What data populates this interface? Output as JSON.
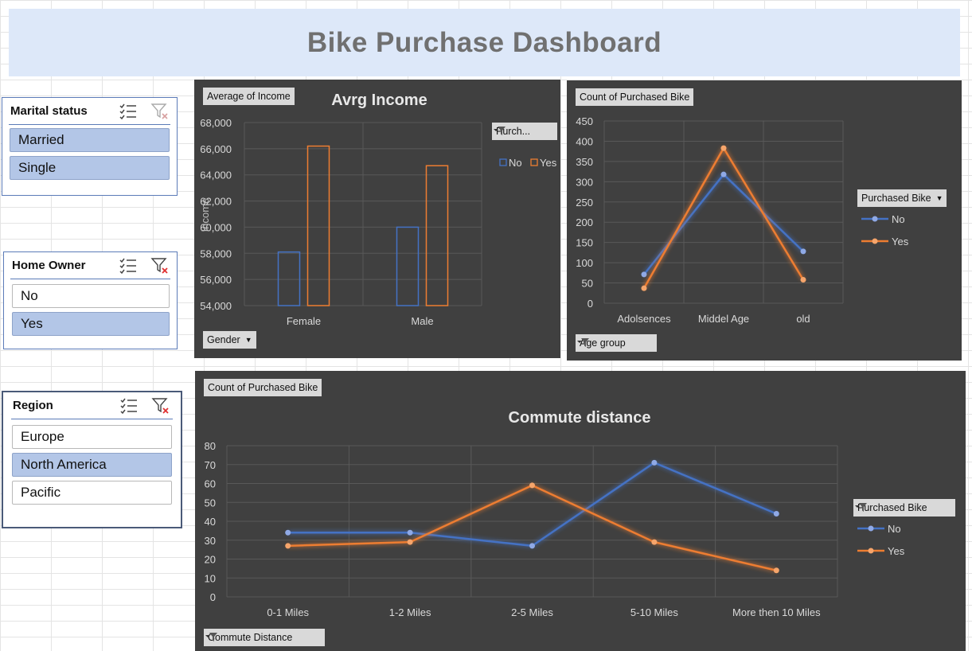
{
  "title": "Bike Purchase Dashboard",
  "colors": {
    "no": "#4472c4",
    "yes": "#ed7d31",
    "panel": "#404040",
    "selected": "#b3c6e7"
  },
  "slicers": {
    "marital": {
      "label": "Marital status",
      "items": [
        {
          "label": "Married",
          "selected": true
        },
        {
          "label": "Single",
          "selected": true
        }
      ],
      "icons": [
        "multi-select-icon",
        "clear-filter-icon"
      ]
    },
    "home_owner": {
      "label": "Home Owner",
      "items": [
        {
          "label": "No",
          "selected": false
        },
        {
          "label": "Yes",
          "selected": true
        }
      ],
      "icons": [
        "multi-select-icon",
        "clear-filter-icon"
      ]
    },
    "region": {
      "label": "Region",
      "items": [
        {
          "label": "Europe",
          "selected": false
        },
        {
          "label": "North America",
          "selected": true
        },
        {
          "label": "Pacific",
          "selected": false
        }
      ],
      "icons": [
        "multi-select-icon",
        "clear-filter-icon"
      ]
    }
  },
  "income_chart": {
    "value_button": "Average of Income",
    "legend_button": "Purch...",
    "axis_button": "Gender"
  },
  "age_chart": {
    "value_button": "Count of Purchased Bike",
    "legend_button": "Purchased Bike",
    "axis_button": "Age group"
  },
  "commute_chart": {
    "value_button": "Count of Purchased Bike",
    "legend_button": "Purchased Bike",
    "axis_button": "Commute Distance"
  },
  "chart_data": [
    {
      "type": "bar",
      "title": "Avrg Income",
      "xlabel": "",
      "ylabel": "Income",
      "categories": [
        "Female",
        "Male"
      ],
      "series": [
        {
          "name": "No",
          "values": [
            58100,
            60000
          ]
        },
        {
          "name": "Yes",
          "values": [
            66200,
            64700
          ]
        }
      ],
      "ylim": [
        54000,
        68000
      ],
      "yticks": [
        "54,000",
        "56,000",
        "58,000",
        "60,000",
        "62,000",
        "64,000",
        "66,000",
        "68,000"
      ],
      "legend": "right",
      "grid": true
    },
    {
      "type": "line",
      "title": "",
      "categories": [
        "Adolsences",
        "Middel Age",
        "old"
      ],
      "series": [
        {
          "name": "No",
          "values": [
            71,
            318,
            128
          ]
        },
        {
          "name": "Yes",
          "values": [
            37,
            383,
            58
          ]
        }
      ],
      "ylim": [
        0,
        450
      ],
      "yticks": [
        "0",
        "50",
        "100",
        "150",
        "200",
        "250",
        "300",
        "350",
        "400",
        "450"
      ],
      "legend": "right",
      "grid": true
    },
    {
      "type": "line",
      "title": "Commute distance",
      "categories": [
        "0-1 Miles",
        "1-2 Miles",
        "2-5 Miles",
        "5-10 Miles",
        "More then 10 Miles"
      ],
      "series": [
        {
          "name": "No",
          "values": [
            34,
            34,
            27,
            71,
            44
          ]
        },
        {
          "name": "Yes",
          "values": [
            27,
            29,
            59,
            29,
            14
          ]
        }
      ],
      "ylim": [
        0,
        80
      ],
      "yticks": [
        "0",
        "10",
        "20",
        "30",
        "40",
        "50",
        "60",
        "70",
        "80"
      ],
      "legend": "right",
      "grid": true
    }
  ]
}
